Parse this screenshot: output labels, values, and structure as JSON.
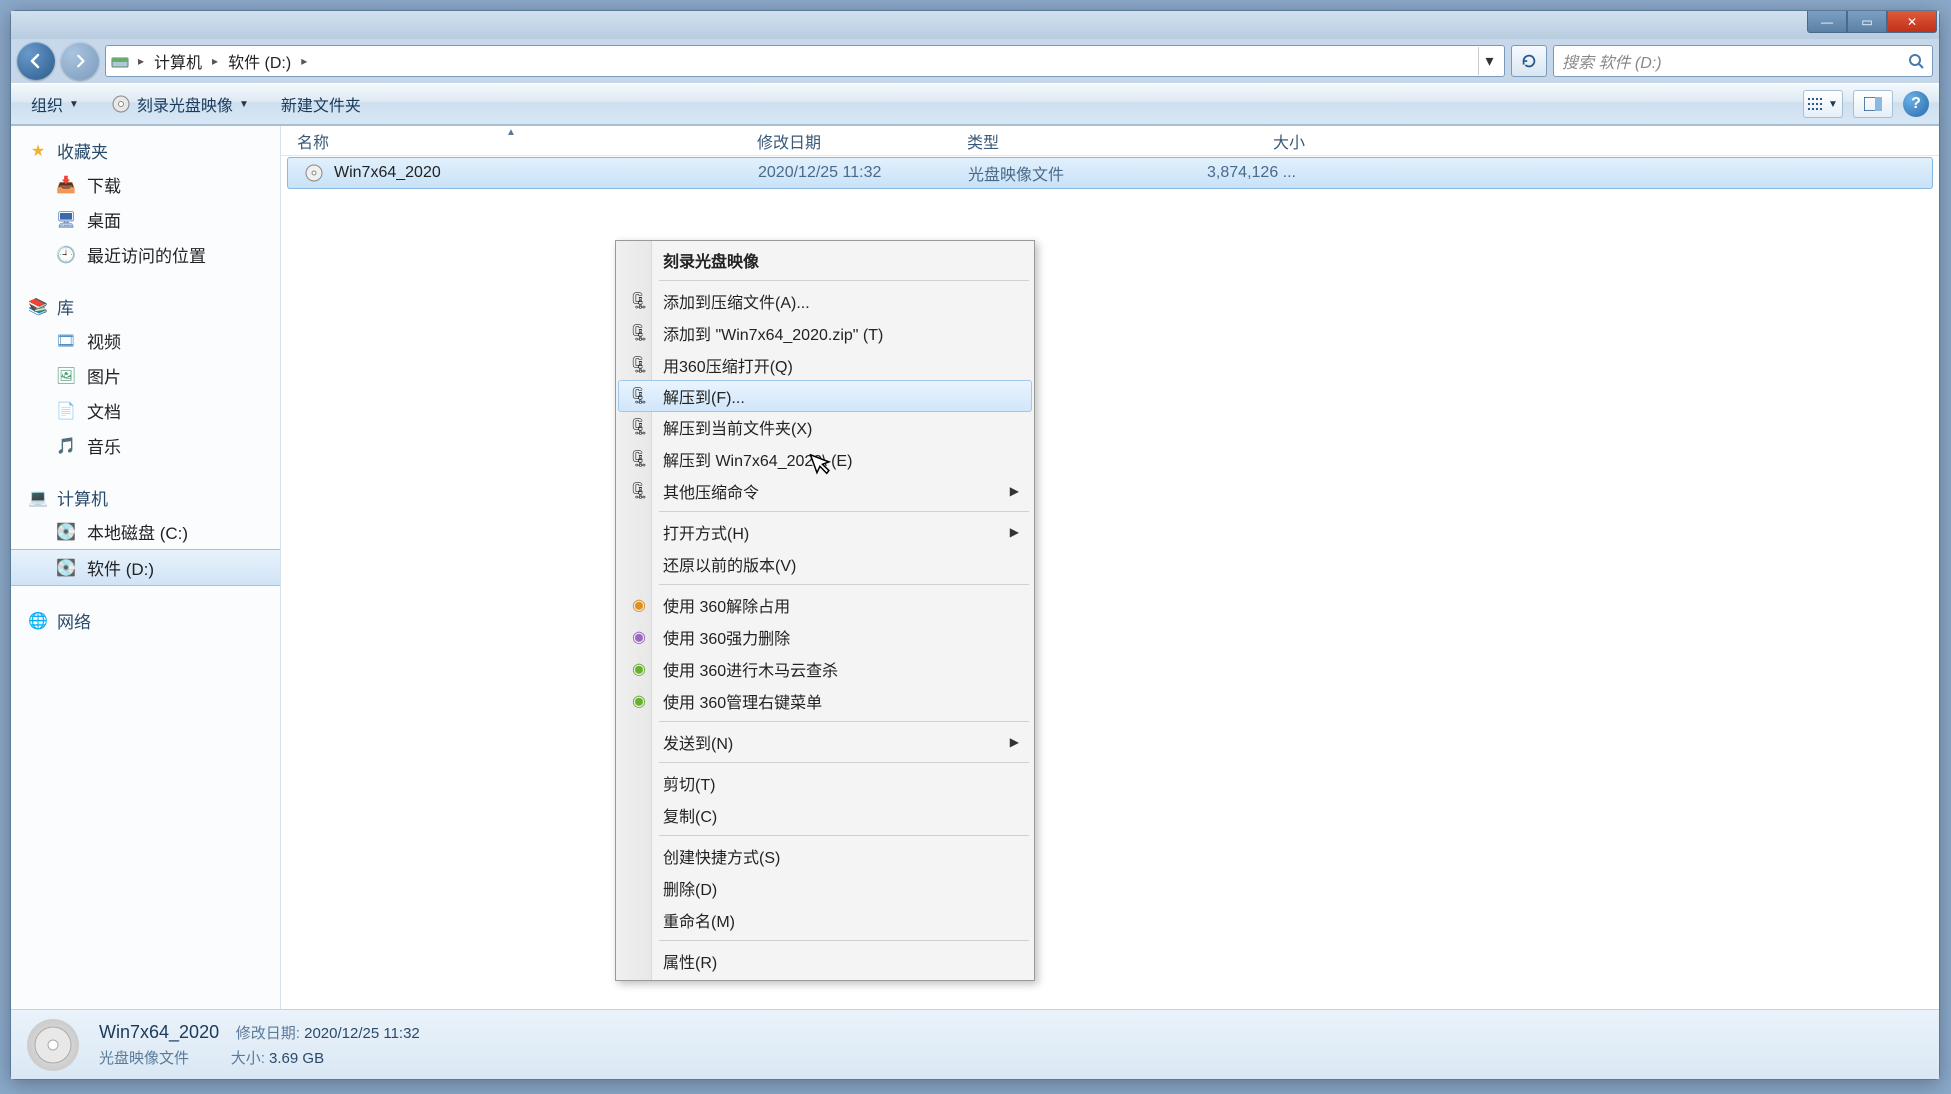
{
  "titlebar": {
    "min": "—",
    "max": "▭",
    "close": "✕"
  },
  "nav": {
    "crumb1": "计算机",
    "crumb2": "软件 (D:)",
    "refresh_tooltip": "刷新",
    "search_placeholder": "搜索 软件 (D:)"
  },
  "toolbar": {
    "organize": "组织",
    "burn": "刻录光盘映像",
    "newfolder": "新建文件夹"
  },
  "sidebar": {
    "favorites": {
      "label": "收藏夹",
      "items": [
        {
          "icon": "⬇",
          "color": "#e6a040",
          "label": "下载"
        },
        {
          "icon": "🖥",
          "color": "#3a6aaa",
          "label": "桌面"
        },
        {
          "icon": "📄",
          "color": "#8aa8c4",
          "label": "最近访问的位置"
        }
      ]
    },
    "libraries": {
      "label": "库",
      "items": [
        {
          "icon": "🎞",
          "color": "#4a8ac0",
          "label": "视频"
        },
        {
          "icon": "🖼",
          "color": "#4a9a6a",
          "label": "图片"
        },
        {
          "icon": "📄",
          "color": "#8a8a6a",
          "label": "文档"
        },
        {
          "icon": "🎵",
          "color": "#4a8ad0",
          "label": "音乐"
        }
      ]
    },
    "computer": {
      "label": "计算机",
      "items": [
        {
          "icon": "💽",
          "color": "#6a8aaa",
          "label": "本地磁盘 (C:)"
        },
        {
          "icon": "💽",
          "color": "#4a9a5a",
          "label": "软件 (D:)",
          "selected": true
        }
      ]
    },
    "network": {
      "label": "网络"
    }
  },
  "columns": {
    "name": "名称",
    "date": "修改日期",
    "type": "类型",
    "size": "大小"
  },
  "files": [
    {
      "name": "Win7x64_2020",
      "date": "2020/12/25 11:32",
      "type": "光盘映像文件",
      "size": "3,874,126 ..."
    }
  ],
  "context": {
    "burn": "刻录光盘映像",
    "add_archive": "添加到压缩文件(A)...",
    "add_zip": "添加到 \"Win7x64_2020.zip\" (T)",
    "open_360": "用360压缩打开(Q)",
    "extract_to": "解压到(F)...",
    "extract_here": "解压到当前文件夹(X)",
    "extract_named": "解压到 Win7x64_2020\\ (E)",
    "other_zip": "其他压缩命令",
    "open_with": "打开方式(H)",
    "restore_prev": "还原以前的版本(V)",
    "u360_unlock": "使用 360解除占用",
    "u360_delete": "使用 360强力删除",
    "u360_scan": "使用 360进行木马云查杀",
    "u360_menu": "使用 360管理右键菜单",
    "send_to": "发送到(N)",
    "cut": "剪切(T)",
    "copy": "复制(C)",
    "shortcut": "创建快捷方式(S)",
    "delete": "删除(D)",
    "rename": "重命名(M)",
    "properties": "属性(R)"
  },
  "details": {
    "filename": "Win7x64_2020",
    "filetype": "光盘映像文件",
    "date_label": "修改日期:",
    "date_value": "2020/12/25 11:32",
    "size_label": "大小:",
    "size_value": "3.69 GB"
  }
}
